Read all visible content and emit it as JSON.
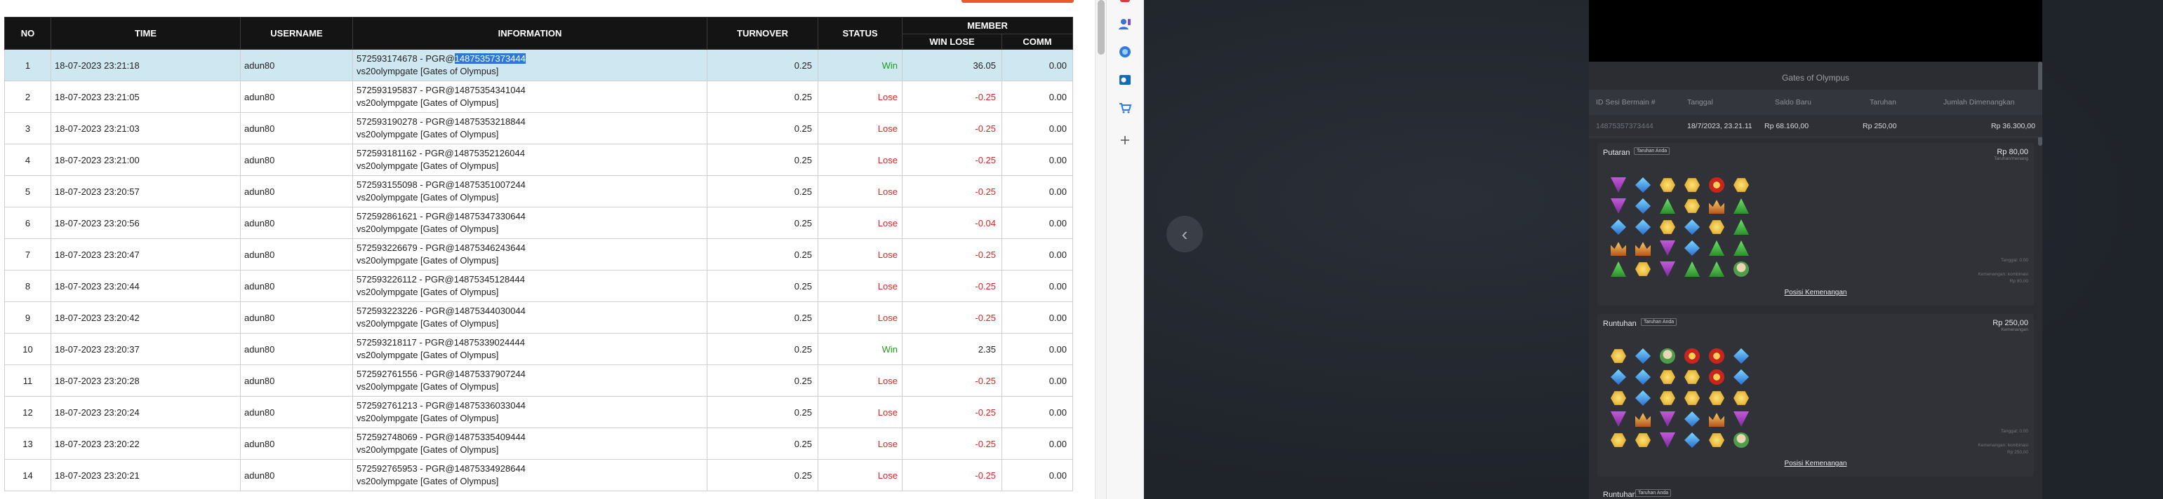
{
  "table": {
    "headers": {
      "no": "NO",
      "time": "TIME",
      "username": "USERNAME",
      "information": "INFORMATION",
      "turnover": "TURNOVER",
      "status": "STATUS",
      "member": "MEMBER",
      "win_lose": "WIN LOSE",
      "comm": "COMM"
    },
    "rows": [
      {
        "no": "1",
        "time": "18-07-2023 23:21:18",
        "username": "adun80",
        "info_prefix": "572593174678 - PGR@",
        "info_highlight": "14875357373444",
        "info_line2": "vs20olympgate [Gates of Olympus]",
        "turnover": "0.25",
        "status": "Win",
        "win_lose": "36.05",
        "comm": "0.00"
      },
      {
        "no": "2",
        "time": "18-07-2023 23:21:05",
        "username": "adun80",
        "info_line1": "572593195837 - PGR@14875354341044",
        "info_line2": "vs20olympgate [Gates of Olympus]",
        "turnover": "0.25",
        "status": "Lose",
        "win_lose": "-0.25",
        "comm": "0.00"
      },
      {
        "no": "3",
        "time": "18-07-2023 23:21:03",
        "username": "adun80",
        "info_line1": "572593190278 - PGR@14875353218844",
        "info_line2": "vs20olympgate [Gates of Olympus]",
        "turnover": "0.25",
        "status": "Lose",
        "win_lose": "-0.25",
        "comm": "0.00"
      },
      {
        "no": "4",
        "time": "18-07-2023 23:21:00",
        "username": "adun80",
        "info_line1": "572593181162 - PGR@14875352126044",
        "info_line2": "vs20olympgate [Gates of Olympus]",
        "turnover": "0.25",
        "status": "Lose",
        "win_lose": "-0.25",
        "comm": "0.00"
      },
      {
        "no": "5",
        "time": "18-07-2023 23:20:57",
        "username": "adun80",
        "info_line1": "572593155098 - PGR@14875351007244",
        "info_line2": "vs20olympgate [Gates of Olympus]",
        "turnover": "0.25",
        "status": "Lose",
        "win_lose": "-0.25",
        "comm": "0.00"
      },
      {
        "no": "6",
        "time": "18-07-2023 23:20:56",
        "username": "adun80",
        "info_line1": "572592861621 - PGR@14875347330644",
        "info_line2": "vs20olympgate [Gates of Olympus]",
        "turnover": "0.25",
        "status": "Lose",
        "win_lose": "-0.04",
        "comm": "0.00"
      },
      {
        "no": "7",
        "time": "18-07-2023 23:20:47",
        "username": "adun80",
        "info_line1": "572593226679 - PGR@14875346243644",
        "info_line2": "vs20olympgate [Gates of Olympus]",
        "turnover": "0.25",
        "status": "Lose",
        "win_lose": "-0.25",
        "comm": "0.00"
      },
      {
        "no": "8",
        "time": "18-07-2023 23:20:44",
        "username": "adun80",
        "info_line1": "572593226112 - PGR@14875345128444",
        "info_line2": "vs20olympgate [Gates of Olympus]",
        "turnover": "0.25",
        "status": "Lose",
        "win_lose": "-0.25",
        "comm": "0.00"
      },
      {
        "no": "9",
        "time": "18-07-2023 23:20:42",
        "username": "adun80",
        "info_line1": "572593223226 - PGR@14875344030044",
        "info_line2": "vs20olympgate [Gates of Olympus]",
        "turnover": "0.25",
        "status": "Lose",
        "win_lose": "-0.25",
        "comm": "0.00"
      },
      {
        "no": "10",
        "time": "18-07-2023 23:20:37",
        "username": "adun80",
        "info_line1": "572593218117 - PGR@14875339024444",
        "info_line2": "vs20olympgate [Gates of Olympus]",
        "turnover": "0.25",
        "status": "Win",
        "win_lose": "2.35",
        "comm": "0.00"
      },
      {
        "no": "11",
        "time": "18-07-2023 23:20:28",
        "username": "adun80",
        "info_line1": "572592761556 - PGR@14875337907244",
        "info_line2": "vs20olympgate [Gates of Olympus]",
        "turnover": "0.25",
        "status": "Lose",
        "win_lose": "-0.25",
        "comm": "0.00"
      },
      {
        "no": "12",
        "time": "18-07-2023 23:20:24",
        "username": "adun80",
        "info_line1": "572592761213 - PGR@14875336033044",
        "info_line2": "vs20olympgate [Gates of Olympus]",
        "turnover": "0.25",
        "status": "Lose",
        "win_lose": "-0.25",
        "comm": "0.00"
      },
      {
        "no": "13",
        "time": "18-07-2023 23:20:22",
        "username": "adun80",
        "info_line1": "572592748069 - PGR@14875335409444",
        "info_line2": "vs20olympgate [Gates of Olympus]",
        "turnover": "0.25",
        "status": "Lose",
        "win_lose": "-0.25",
        "comm": "0.00"
      },
      {
        "no": "14",
        "time": "18-07-2023 23:20:21",
        "username": "adun80",
        "info_line1": "572592765953 - PGR@14875334928644",
        "info_line2": "vs20olympgate [Gates of Olympus]",
        "turnover": "0.25",
        "status": "Lose",
        "win_lose": "-0.25",
        "comm": "0.00"
      }
    ]
  },
  "dock": {
    "icons": [
      "office-app-icon",
      "user-profile-icon",
      "copilot-icon",
      "outlook-icon",
      "shopping-cart-icon",
      "add-icon"
    ]
  },
  "viewer": {
    "panel_title": "Gates of Olympus",
    "summary_headers": [
      "ID Sesi Bermain #",
      "Tanggal",
      "Saldo Baru",
      "Taruhan",
      "Jumlah Dimenangkan"
    ],
    "summary_values": [
      "14875357373444",
      "18/7/2023, 23.21.11",
      "Rp 68.160,00",
      "Rp 250,00",
      "Rp 36.300,00"
    ],
    "blocks": [
      {
        "title": "Putaran",
        "tag": "Taruhan Anda",
        "amount": "Rp 80,00",
        "sub": "Taruhan/menang",
        "note1": "Tanggal: 0.00",
        "note2": "Kemenangan: kombinasi",
        "note3": "Rp 80,00",
        "link": "Posisi Kemenangan"
      },
      {
        "title": "Runtuhan",
        "tag": "Taruhan Anda",
        "amount": "Rp 250,00",
        "sub": "Kemenangan",
        "note1": "Tanggal: 0.00",
        "note2": "Kemenangan: kombinasi",
        "note3": "Rp 250,00",
        "link": "Posisi Kemenangan"
      }
    ],
    "block3_title": "Runtuhan",
    "block3_tag": "Taruhan Anda",
    "reel1": [
      [
        "tri-p",
        "dia-b",
        "hex-y",
        "hex-y",
        "ring-r",
        "hex-y"
      ],
      [
        "tri-p",
        "dia-b",
        "tri-g",
        "hex-y",
        "crown",
        "tri-g"
      ],
      [
        "dia-b",
        "dia-b",
        "hex-y",
        "dia-b",
        "hex-y",
        "tri-g"
      ],
      [
        "crown",
        "crown",
        "tri-p",
        "dia-b",
        "tri-g",
        "tri-g"
      ],
      [
        "tri-g",
        "hex-y",
        "tri-p",
        "tri-g",
        "tri-g",
        "zeus"
      ]
    ],
    "reel2": [
      [
        "hex-y",
        "dia-b",
        "zeus",
        "ring-r",
        "ring-r",
        "dia-b"
      ],
      [
        "dia-b",
        "dia-b",
        "hex-y",
        "hex-y",
        "ring-r",
        "dia-b"
      ],
      [
        "hex-y",
        "dia-b",
        "hex-y",
        "hex-y",
        "hex-y",
        "hex-y"
      ],
      [
        "tri-p",
        "crown",
        "tri-p",
        "dia-b",
        "crown",
        "tri-p"
      ],
      [
        "hex-y",
        "hex-y",
        "tri-p",
        "dia-b",
        "hex-y",
        "zeus"
      ]
    ]
  }
}
